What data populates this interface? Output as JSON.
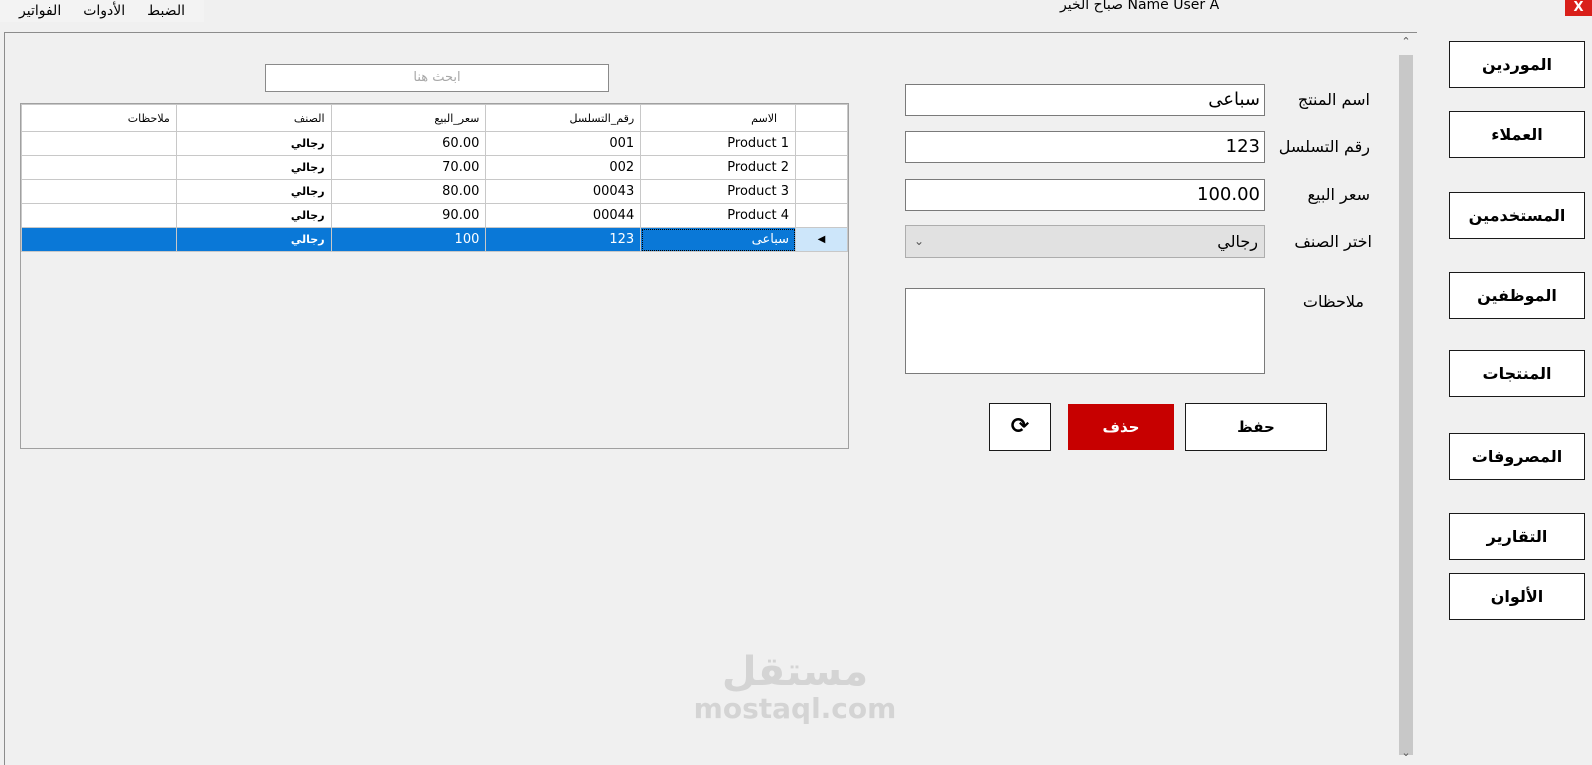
{
  "menu": {
    "items": [
      "الفواتير",
      "الأدوات",
      "الضبط"
    ]
  },
  "header": {
    "greeting": "صباح الخير Name User A",
    "close_label": "X"
  },
  "search": {
    "placeholder": "ابحث هنا"
  },
  "grid": {
    "columns": [
      "الاسم",
      "رقم_التسلسل",
      "سعر_البيع",
      "الصنف",
      "ملاحظات"
    ],
    "rows": [
      {
        "name": "Product 1",
        "serial": "001",
        "price": "60.00",
        "category": "رجالي",
        "notes": ""
      },
      {
        "name": "Product 2",
        "serial": "002",
        "price": "70.00",
        "category": "رجالي",
        "notes": ""
      },
      {
        "name": "Product 3",
        "serial": "00043",
        "price": "80.00",
        "category": "رجالي",
        "notes": ""
      },
      {
        "name": "Product 4",
        "serial": "00044",
        "price": "90.00",
        "category": "رجالي",
        "notes": ""
      },
      {
        "name": "سباعى",
        "serial": "123",
        "price": "100",
        "category": "رجالي",
        "notes": ""
      }
    ],
    "selected_row": 4
  },
  "form": {
    "product_name_label": "اسم المنتج",
    "product_name_value": "سباعى",
    "serial_label": "رقم التسلسل",
    "serial_value": "123",
    "price_label": "سعر البيع",
    "price_value": "100.00",
    "category_label": "اختر الصنف",
    "category_value": "رجالي",
    "notes_label": "ملاحظات"
  },
  "actions": {
    "save_label": "حفظ",
    "delete_label": "حذف",
    "refresh_icon": "refresh-icon"
  },
  "nav": {
    "items": [
      "الموردين",
      "العملاء",
      "المستخدمين",
      "الموظفين",
      "المنتجات",
      "المصروفات",
      "التقارير",
      "الألوان"
    ]
  },
  "watermark": {
    "arabic": "مستقل",
    "latin": "mostaql.com"
  },
  "colors": {
    "selection": "#0a78d7",
    "delete": "#c70000",
    "close": "#d9201a"
  }
}
